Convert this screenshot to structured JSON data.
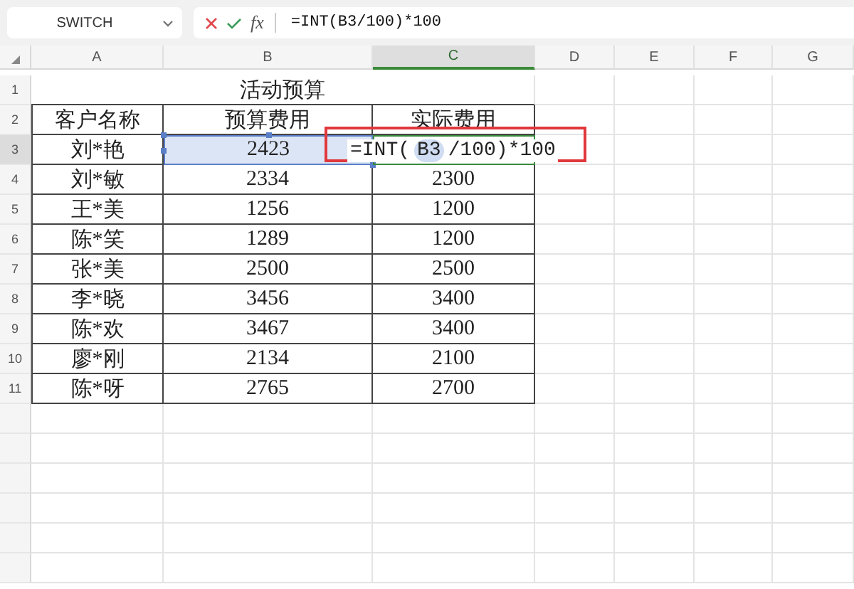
{
  "name_box": {
    "value": "SWITCH"
  },
  "formula_bar": {
    "function_label": "fx",
    "value": "=INT(B3/100)*100"
  },
  "columns": [
    {
      "label": "A",
      "selected": false
    },
    {
      "label": "B",
      "selected": false
    },
    {
      "label": "C",
      "selected": true
    },
    {
      "label": "D",
      "selected": false
    },
    {
      "label": "E",
      "selected": false
    },
    {
      "label": "F",
      "selected": false
    },
    {
      "label": "G",
      "selected": false
    }
  ],
  "rows": [
    {
      "number": "1",
      "selected": false,
      "cells": [
        {
          "kind": "title",
          "text": "活动预算"
        }
      ]
    },
    {
      "number": "2",
      "selected": false,
      "cells": [
        {
          "kind": "text",
          "text": "客户名称"
        },
        {
          "kind": "text",
          "text": "预算费用"
        },
        {
          "kind": "text",
          "text": "实际费用"
        }
      ]
    },
    {
      "number": "3",
      "selected": true,
      "cells": [
        {
          "kind": "text",
          "text": "刘*艳"
        },
        {
          "kind": "referenced",
          "text": "2423"
        },
        {
          "kind": "formula",
          "parts": [
            {
              "kind": "plain",
              "text": "=INT("
            },
            {
              "kind": "ref",
              "text": "B3"
            },
            {
              "kind": "plain",
              "text": "/100)*100"
            }
          ]
        }
      ]
    },
    {
      "number": "4",
      "selected": false,
      "cells": [
        {
          "kind": "text",
          "text": "刘*敏"
        },
        {
          "kind": "text",
          "text": "2334"
        },
        {
          "kind": "text",
          "text": "2300"
        }
      ]
    },
    {
      "number": "5",
      "selected": false,
      "cells": [
        {
          "kind": "text",
          "text": "王*美"
        },
        {
          "kind": "text",
          "text": "1256"
        },
        {
          "kind": "text",
          "text": "1200"
        }
      ]
    },
    {
      "number": "6",
      "selected": false,
      "cells": [
        {
          "kind": "text",
          "text": "陈*笑"
        },
        {
          "kind": "text",
          "text": "1289"
        },
        {
          "kind": "text",
          "text": "1200"
        }
      ]
    },
    {
      "number": "7",
      "selected": false,
      "cells": [
        {
          "kind": "text",
          "text": "张*美"
        },
        {
          "kind": "text",
          "text": "2500"
        },
        {
          "kind": "text",
          "text": "2500"
        }
      ]
    },
    {
      "number": "8",
      "selected": false,
      "cells": [
        {
          "kind": "text",
          "text": "李*晓"
        },
        {
          "kind": "text",
          "text": "3456"
        },
        {
          "kind": "text",
          "text": "3400"
        }
      ]
    },
    {
      "number": "9",
      "selected": false,
      "cells": [
        {
          "kind": "text",
          "text": "陈*欢"
        },
        {
          "kind": "text",
          "text": "3467"
        },
        {
          "kind": "text",
          "text": "3400"
        }
      ]
    },
    {
      "number": "10",
      "selected": false,
      "cells": [
        {
          "kind": "text",
          "text": "廖*刚"
        },
        {
          "kind": "text",
          "text": "2134"
        },
        {
          "kind": "text",
          "text": "2100"
        }
      ]
    },
    {
      "number": "11",
      "selected": false,
      "cells": [
        {
          "kind": "text",
          "text": "陈*呀"
        },
        {
          "kind": "text",
          "text": "2765"
        },
        {
          "kind": "text",
          "text": "2700"
        }
      ]
    }
  ]
}
